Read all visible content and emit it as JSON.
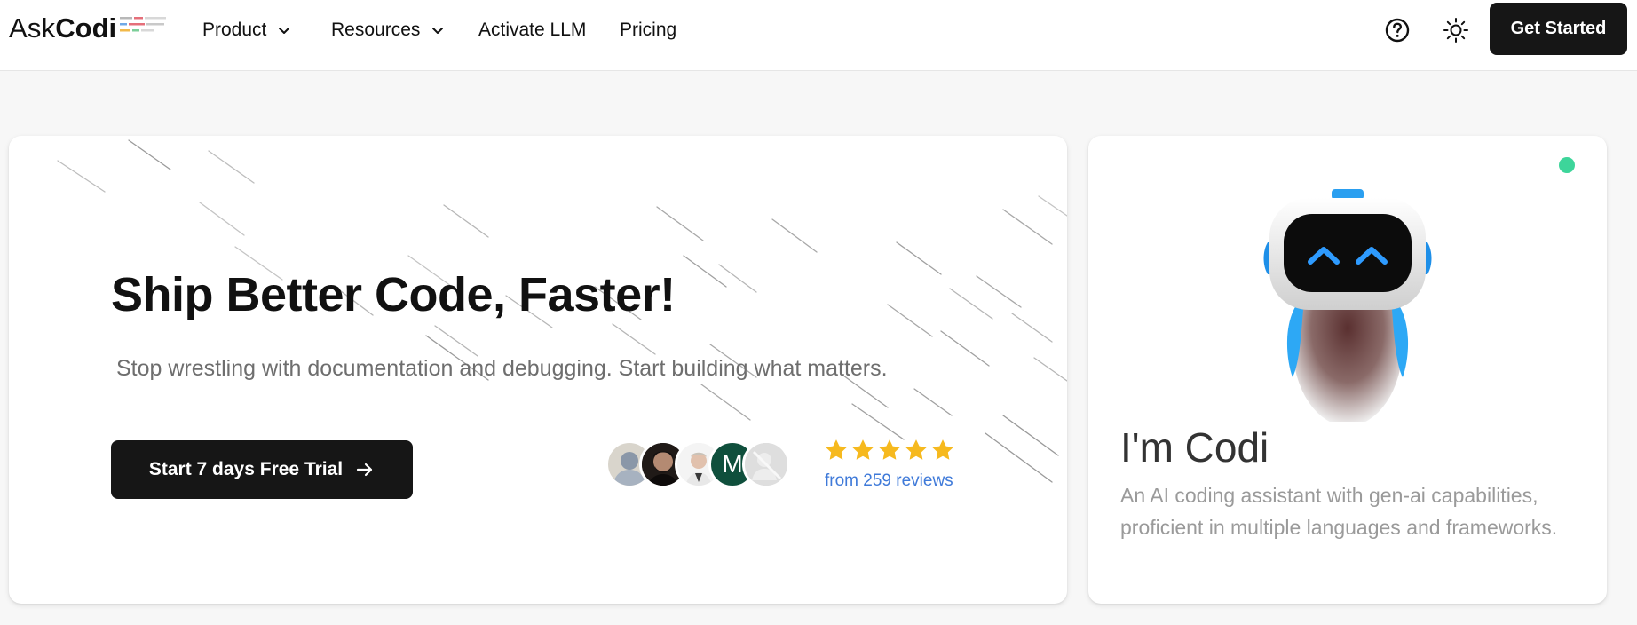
{
  "header": {
    "logo": {
      "part1": "Ask",
      "part2": "Codi"
    },
    "nav": [
      {
        "label": "Product",
        "has_dropdown": true
      },
      {
        "label": "Resources",
        "has_dropdown": true
      },
      {
        "label": "Activate LLM",
        "has_dropdown": false
      },
      {
        "label": "Pricing",
        "has_dropdown": false
      }
    ],
    "help_icon": "question-circle-icon",
    "theme_icon": "sun-icon",
    "cta_label": "Get Started"
  },
  "hero": {
    "title": "Ship Better Code, Faster!",
    "subtitle": "Stop wrestling with documentation and debugging. Start building what matters.",
    "trial_button_label": "Start 7 days Free Trial",
    "trial_button_icon": "arrow-right-icon",
    "avatars": [
      {
        "type": "placeholder-person",
        "bg": "#d9d5cc"
      },
      {
        "type": "photo-dark",
        "bg": "#2a2320"
      },
      {
        "type": "photo-light",
        "bg": "#f1f1f1"
      },
      {
        "type": "initial",
        "initial": "M",
        "bg": "#0f4f3c"
      },
      {
        "type": "placeholder-hidden",
        "bg": "#d6d6d6"
      }
    ],
    "rating_stars": 5,
    "star_color": "#f6b91e",
    "reviews_text": "from 259 reviews"
  },
  "codi_card": {
    "status_color": "#3dd59a",
    "title": "I'm Codi",
    "description": "An AI coding assistant with gen-ai capabilities, proficient in multiple languages and frameworks."
  },
  "colors": {
    "button_dark": "#161616",
    "link_blue": "#3f7ad9",
    "accent_blue": "#1e9bf0"
  }
}
